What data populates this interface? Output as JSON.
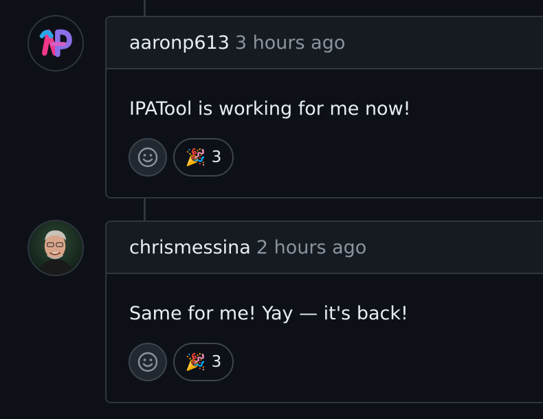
{
  "comments": [
    {
      "author": "aaronp613",
      "time": "3 hours ago",
      "body": "IPATool is working for me now!",
      "reaction_emoji": "🎉",
      "reaction_count": "3"
    },
    {
      "author": "chrismessina",
      "time": "2 hours ago",
      "body": "Same for me! Yay — it's back!",
      "reaction_emoji": "🎉",
      "reaction_count": "3"
    }
  ]
}
